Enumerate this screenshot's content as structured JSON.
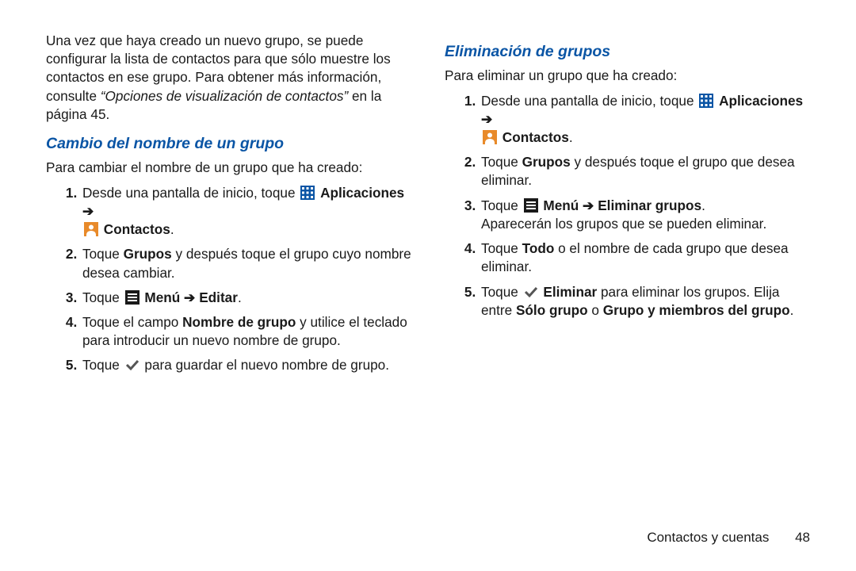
{
  "left": {
    "intro_pre": "Una vez que haya creado un nuevo grupo, se puede configurar la lista de contactos para que sólo muestre los contactos en ese grupo. Para obtener más información, consulte ",
    "intro_ref": "“Opciones de visualización de contactos”",
    "intro_post": " en la página 45.",
    "heading": "Cambio del nombre de un grupo",
    "lede": "Para cambiar el nombre de un grupo que ha creado:",
    "s1_a": "Desde una pantalla de inicio, toque ",
    "s1_apps": "Aplicaciones",
    "s1_arrow": " ➔ ",
    "s1_contacts": "Contactos",
    "s1_period": ".",
    "s2_a": "Toque ",
    "s2_groups": "Grupos",
    "s2_b": " y después toque el grupo cuyo nombre desea cambiar.",
    "s3_a": "Toque ",
    "s3_menu": "Menú",
    "s3_arrow": " ➔ ",
    "s3_edit": "Editar",
    "s3_period": ".",
    "s4_a": "Toque el campo ",
    "s4_field": "Nombre de grupo",
    "s4_b": " y utilice el teclado para introducir un nuevo nombre de grupo.",
    "s5_a": "Toque ",
    "s5_b": " para guardar el nuevo nombre de grupo."
  },
  "right": {
    "heading": "Eliminación de grupos",
    "lede": "Para eliminar un grupo que ha creado:",
    "s1_a": "Desde una pantalla de inicio, toque ",
    "s1_apps": "Aplicaciones",
    "s1_arrow": " ➔ ",
    "s1_contacts": "Contactos",
    "s1_period": ".",
    "s2_a": "Toque ",
    "s2_groups": "Grupos",
    "s2_b": " y después toque el grupo que desea eliminar.",
    "s3_a": "Toque ",
    "s3_menu": "Menú",
    "s3_arrow": " ➔ ",
    "s3_del": "Eliminar grupos",
    "s3_period": ".",
    "s3_more": "Aparecerán los grupos que se pueden eliminar.",
    "s4_a": "Toque ",
    "s4_all": "Todo",
    "s4_b": " o el nombre de cada grupo que desea eliminar.",
    "s5_a": "Toque ",
    "s5_del": "Eliminar",
    "s5_b": " para eliminar los grupos. Elija entre ",
    "s5_opt1": "Sólo grupo",
    "s5_or": " o ",
    "s5_opt2": "Grupo y miembros del grupo",
    "s5_period": "."
  },
  "footer": {
    "section": "Contactos y cuentas",
    "page": "48"
  }
}
